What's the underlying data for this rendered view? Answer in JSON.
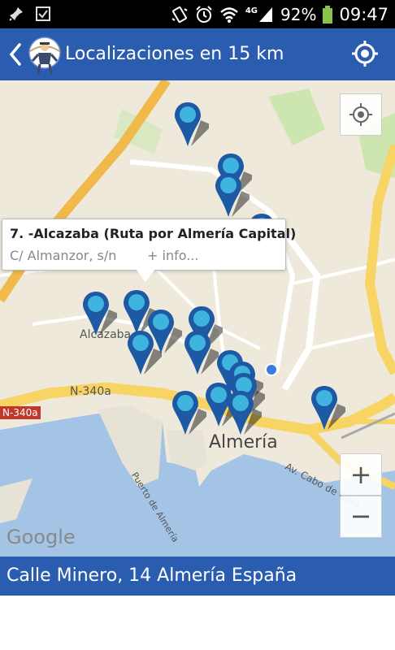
{
  "status_bar": {
    "battery": "92%",
    "network": "4G",
    "time": "09:47",
    "icons": [
      "pin-icon",
      "checkbox-icon",
      "vibrate-icon",
      "alarm-icon",
      "wifi-icon",
      "signal-icon",
      "battery-icon"
    ]
  },
  "app_bar": {
    "title": "Localizaciones en 15 km",
    "icons": [
      "back-arrow-icon",
      "app-logo-icon",
      "locate-icon"
    ]
  },
  "map": {
    "labels": {
      "alcazaba": "Alcazaba",
      "almeria": "Almería",
      "road_n340a": "N-340a",
      "road_340a": "N-340a",
      "puerto": "Puerto de Almería",
      "avenida": "Av. Cabo de Gata",
      "google": "Google"
    },
    "popup": {
      "title": "7. -Alcazaba (Ruta por Almería Capital)",
      "address": "C/ Almanzor, s/n",
      "info": "+ info..."
    },
    "controls": {
      "zoom_in": "+",
      "zoom_out": "−"
    },
    "colors": {
      "pin": "#1e5aa3",
      "pin_highlight": "#3fb4de",
      "road_major": "#f7d463",
      "water": "#a4c4e6",
      "user_location": "#3a7be0"
    }
  },
  "footer": {
    "address": "Calle Minero, 14 Almería España"
  }
}
